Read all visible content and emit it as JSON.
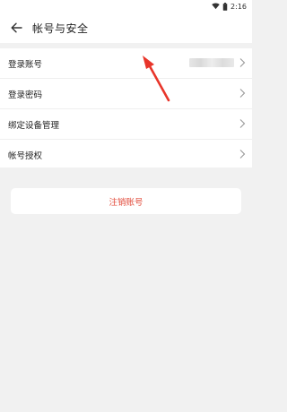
{
  "status_bar": {
    "time": "2:16",
    "icons": [
      "wifi-icon",
      "battery-icon"
    ]
  },
  "header": {
    "title": "帐号与安全",
    "back_icon": "back-arrow-icon"
  },
  "settings": {
    "items": [
      {
        "label": "登录账号",
        "value_obscured": true
      },
      {
        "label": "登录密码"
      },
      {
        "label": "绑定设备管理"
      },
      {
        "label": "帐号授权"
      }
    ]
  },
  "actions": {
    "logout_label": "注销账号"
  },
  "colors": {
    "accent_red": "#e24a3a",
    "background": "#f1f1f1",
    "annotation_red": "#e8352a"
  }
}
